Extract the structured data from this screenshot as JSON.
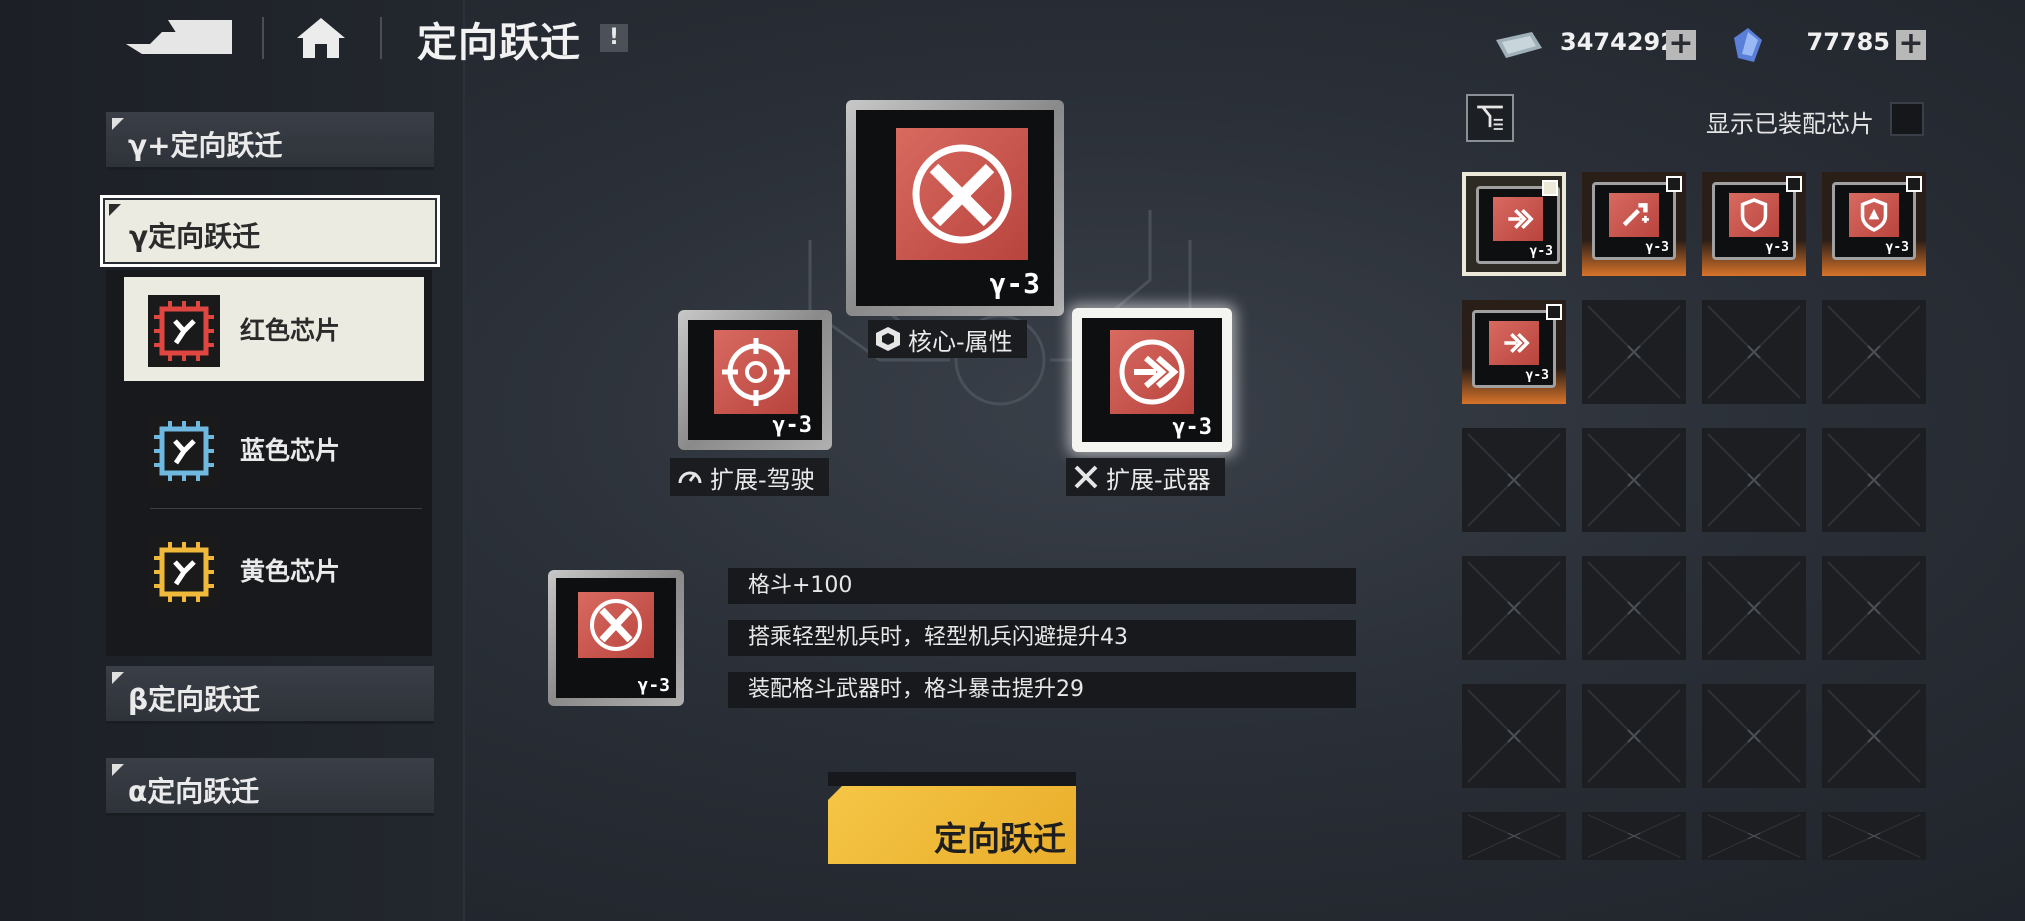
{
  "header": {
    "title": "定向跃迁",
    "info_label": "!",
    "currency_1": {
      "icon": "cash-icon",
      "value": "3474292",
      "add": "+"
    },
    "currency_2": {
      "icon": "crystal-icon",
      "value": "77785",
      "add": "+"
    }
  },
  "menu": {
    "tabs": [
      {
        "label": "γ+定向跃迁"
      },
      {
        "label": "γ定向跃迁"
      },
      {
        "label": "β定向跃迁"
      },
      {
        "label": "α定向跃迁"
      }
    ],
    "sub_items": [
      {
        "label": "红色芯片",
        "color": "#e04640"
      },
      {
        "label": "蓝色芯片",
        "color": "#6fb8e0"
      },
      {
        "label": "黄色芯片",
        "color": "#f0b93a"
      }
    ]
  },
  "slots": {
    "core": {
      "label": "核心-属性",
      "tag": "γ-3"
    },
    "drive": {
      "label": "扩展-驾驶",
      "tag": "γ-3"
    },
    "weapon": {
      "label": "扩展-武器",
      "tag": "γ-3"
    }
  },
  "preview": {
    "tag": "γ-3"
  },
  "stats": [
    "格斗+100",
    "搭乘轻型机兵时，轻型机兵闪避提升43",
    "装配格斗武器时，格斗暴击提升29"
  ],
  "action": {
    "label": "定向跃迁"
  },
  "inventory": {
    "show_equipped_label": "显示已装配芯片",
    "items": [
      {
        "icon": "arrow-right-icon",
        "tag": "γ-3"
      },
      {
        "icon": "wrench-plus-icon",
        "tag": "γ-3"
      },
      {
        "icon": "shield-icon",
        "tag": "γ-3"
      },
      {
        "icon": "triangle-badge-icon",
        "tag": "γ-3"
      },
      {
        "icon": "arrow-right-icon",
        "tag": "γ-3"
      }
    ]
  },
  "colors": {
    "accent_yellow": "#f6c646",
    "chip_red": "#c9524a",
    "selected_frame": "#ece9d8"
  }
}
